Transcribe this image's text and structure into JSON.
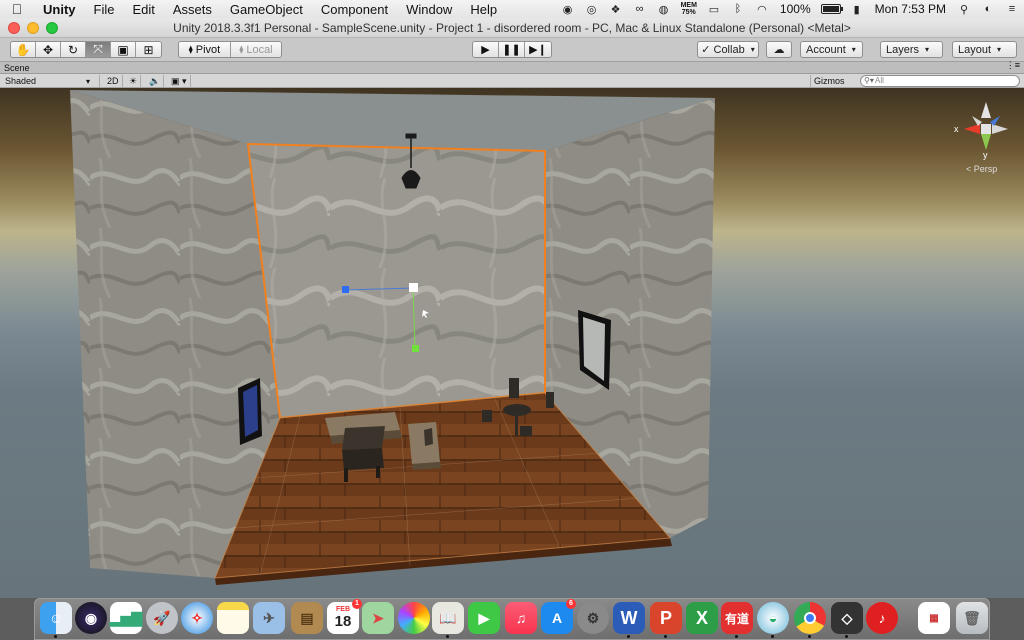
{
  "menubar": {
    "apple": "",
    "items": [
      "Unity",
      "File",
      "Edit",
      "Assets",
      "GameObject",
      "Component",
      "Window",
      "Help"
    ],
    "mem_label": "MEM",
    "mem_value": "75%",
    "battery_percent": "100%",
    "clock": "Mon 7:53 PM"
  },
  "window": {
    "title": "Unity 2018.3.3f1 Personal - SampleScene.unity - Project 1 - disordered room - PC, Mac & Linux Standalone (Personal) <Metal>"
  },
  "toolbar": {
    "pivot_label": "Pivot",
    "local_label": "Local",
    "collab_label": "Collab",
    "account_label": "Account",
    "layers_label": "Layers",
    "layout_label": "Layout"
  },
  "scene": {
    "tab_label": "Scene",
    "shading_mode": "Shaded",
    "mode_2d": "2D",
    "gizmos_label": "Gizmos",
    "search_placeholder": "All",
    "persp_label": "< Persp",
    "axis_x": "x",
    "axis_y": "y"
  },
  "dock": {
    "calendar_month": "FEB",
    "calendar_day": "18",
    "calendar_badge": "1",
    "appstore_badge": "6",
    "youdao_label": "有道"
  }
}
